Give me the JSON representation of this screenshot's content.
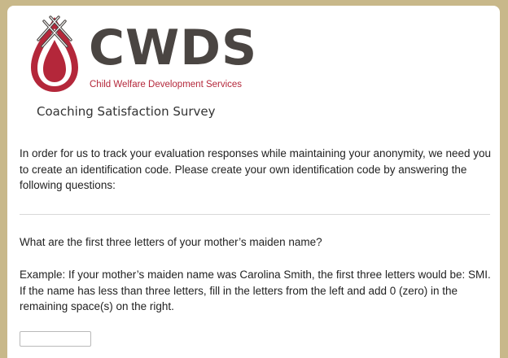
{
  "brand": {
    "name": "CWDS",
    "subtitle": "Child Welfare Development Services",
    "logo_icon": "flame-drop-icon",
    "logo_color": "#b4273a",
    "text_color": "#4a4542"
  },
  "survey": {
    "title": "Coaching Satisfaction Survey",
    "intro": "In order for us to track your evaluation responses while maintaining your anonymity, we need you to create an identification code. Please create your own identification code by answering the following questions:"
  },
  "question1": {
    "text": "What are the first three letters of your mother’s maiden name?",
    "example": "Example: If your mother’s maiden name was Carolina Smith, the first three letters would be: SMI. If the name has less than three letters, fill in the letters from the left and add 0 (zero) in the remaining space(s) on the right.",
    "value": "",
    "placeholder": ""
  },
  "colors": {
    "frame": "#c8b88a",
    "card": "#ffffff",
    "divider": "#d8d8d8"
  }
}
